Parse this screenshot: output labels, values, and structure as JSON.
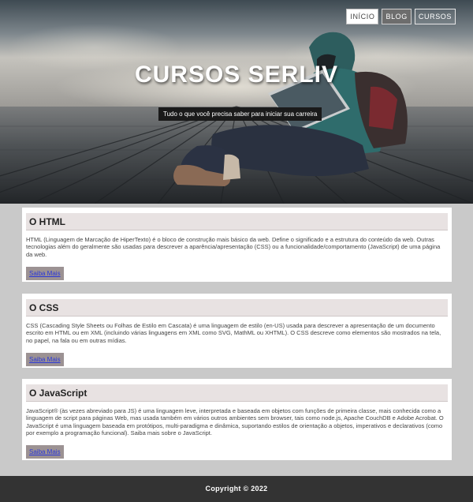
{
  "nav": {
    "items": [
      "INÍCIO",
      "BLOG",
      "CURSOS"
    ]
  },
  "hero": {
    "title": "CURSOS SERLIV",
    "subtitle": "Tudo o que você precisa saber para iniciar sua carreira"
  },
  "cards": [
    {
      "title": "O HTML",
      "text": "HTML (Linguagem de Marcação de HiperTexto) é o bloco de construção mais básico da web. Define o significado e a estrutura do conteúdo da web. Outras tecnologias além do geralmente são usadas para descrever a aparência/apresentação (CSS) ou a funcionalidade/comportamento (JavaScript) de uma página da web.",
      "button": "Saiba Mais"
    },
    {
      "title": "O CSS",
      "text": "CSS (Cascading Style Sheets ou Folhas de Estilo em Cascata) é uma linguagem de estilo (en-US) usada para descrever a apresentação de um documento escrito em HTML ou em XML (incluindo várias linguagens em XML como SVG, MathML ou XHTML). O CSS descreve como elementos são mostrados na tela, no papel, na fala ou em outras mídias.",
      "button": "Saiba Mais"
    },
    {
      "title": "O JavaScript",
      "text": "JavaScript® (às vezes abreviado para JS) é uma linguagem leve, interpretada e baseada em objetos com funções de primeira classe, mais conhecida como a linguagem de script para páginas Web, mas usada também em vários outros ambientes sem browser, tais como node.js, Apache CouchDB e Adobe Acrobat. O JavaScript é uma linguagem baseada em protótipos, multi-paradigma e dinâmica, suportando estilos de orientação a objetos, imperativos e declarativos (como por exemplo a programação funcional). Saiba mais sobre o JavaScript.",
      "button": "Saiba Mais"
    }
  ],
  "footer": {
    "text": "Copyright © 2022"
  }
}
